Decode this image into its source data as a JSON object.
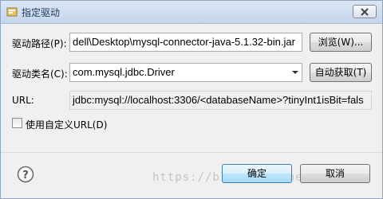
{
  "window": {
    "title": "指定驱动"
  },
  "driver_path": {
    "label": "驱动路径(P):",
    "value": "dell\\Desktop\\mysql-connector-java-5.1.32-bin.jar",
    "browse_label": "浏览(W)..."
  },
  "driver_class": {
    "label": "驱动类名(C):",
    "value": "com.mysql.jdbc.Driver",
    "auto_fetch_label": "自动获取(T)"
  },
  "url": {
    "label": "URL:",
    "value": "jdbc:mysql://localhost:3306/<databaseName>?tinyInt1isBit=fals"
  },
  "custom_url": {
    "label": "使用自定义URL(D)",
    "checked": false
  },
  "footer": {
    "ok_label": "确定",
    "cancel_label": "取消"
  },
  "watermark": "https://blog.csdn.net/boywcx",
  "icons": {
    "app": "app-icon",
    "close": "close-icon",
    "dropdown": "chevron-down-icon",
    "help": "help-icon"
  }
}
